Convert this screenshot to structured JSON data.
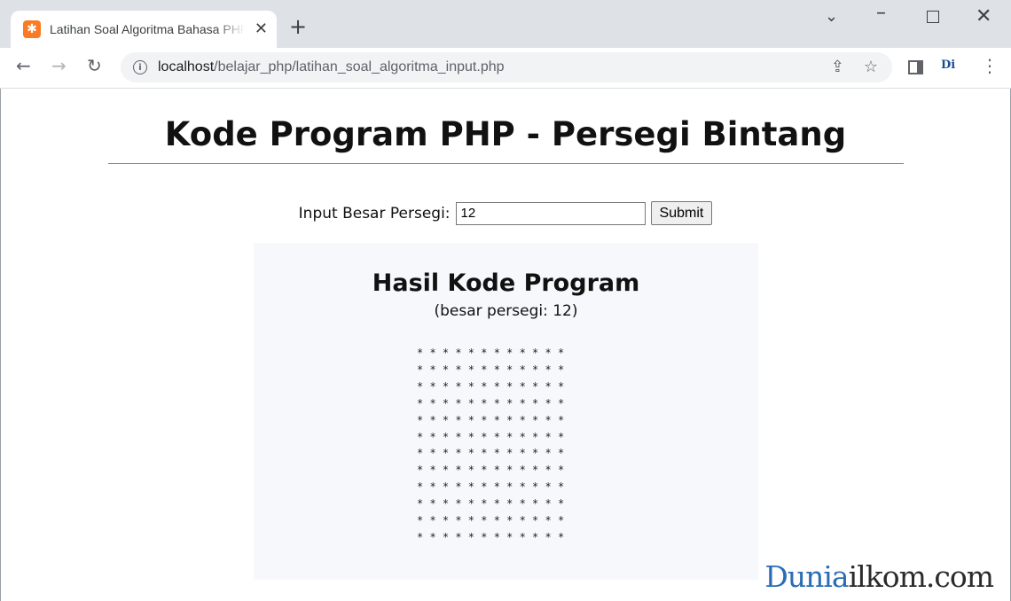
{
  "browser": {
    "tab_title": "Latihan Soal Algoritma Bahasa PHP",
    "url_host": "localhost",
    "url_path": "/belajar_php/latihan_soal_algoritma_input.php",
    "extension_label": "Di",
    "icons": [
      "xampp-favicon",
      "close-icon",
      "plus-icon",
      "chevron-down-icon",
      "minimize-icon",
      "maximize-icon",
      "close-window-icon",
      "back-arrow-icon",
      "forward-arrow-icon",
      "reload-icon",
      "info-icon",
      "share-icon",
      "star-icon",
      "sidepanel-icon",
      "kebab-menu-icon"
    ]
  },
  "page": {
    "title": "Kode Program PHP - Persegi Bintang",
    "form": {
      "label": "Input Besar Persegi:",
      "input_value": "12",
      "submit_label": "Submit"
    },
    "result": {
      "title": "Hasil Kode Program",
      "subtitle": "(besar persegi: 12)",
      "stars": "* * * * * * * * * * * *\n* * * * * * * * * * * *\n* * * * * * * * * * * *\n* * * * * * * * * * * *\n* * * * * * * * * * * *\n* * * * * * * * * * * *\n* * * * * * * * * * * *\n* * * * * * * * * * * *\n* * * * * * * * * * * *\n* * * * * * * * * * * *\n* * * * * * * * * * * *\n* * * * * * * * * * * *"
    },
    "watermark": {
      "part1": "Dunia",
      "part2": "ilkom.com"
    }
  },
  "colors": {
    "result_bg": "#f7f8fc",
    "watermark_blue": "#2a6db5"
  }
}
